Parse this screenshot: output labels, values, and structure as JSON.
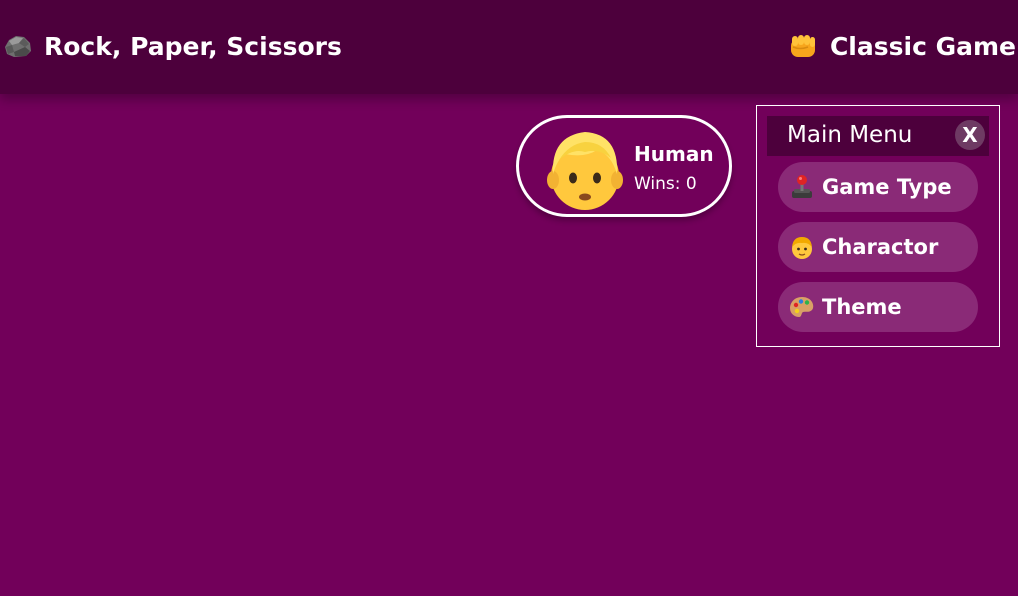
{
  "header": {
    "title": "Rock, Paper, Scissors",
    "title_icon": "rock-icon",
    "mode": "Classic Game",
    "mode_icon": "fist-icon"
  },
  "player": {
    "name": "Human",
    "wins": "Wins: 0",
    "avatar_icon": "person-blond-hair-icon"
  },
  "menu": {
    "title": "Main Menu",
    "close_label": "X",
    "items": [
      {
        "label": "Game Type",
        "icon": "joystick-icon"
      },
      {
        "label": "Charactor",
        "icon": "person-icon"
      },
      {
        "label": "Theme",
        "icon": "palette-icon"
      }
    ]
  },
  "colors": {
    "background": "#72005a",
    "header": "#4d003c",
    "menu_item": "#8a2a77",
    "text": "#ffffff"
  }
}
